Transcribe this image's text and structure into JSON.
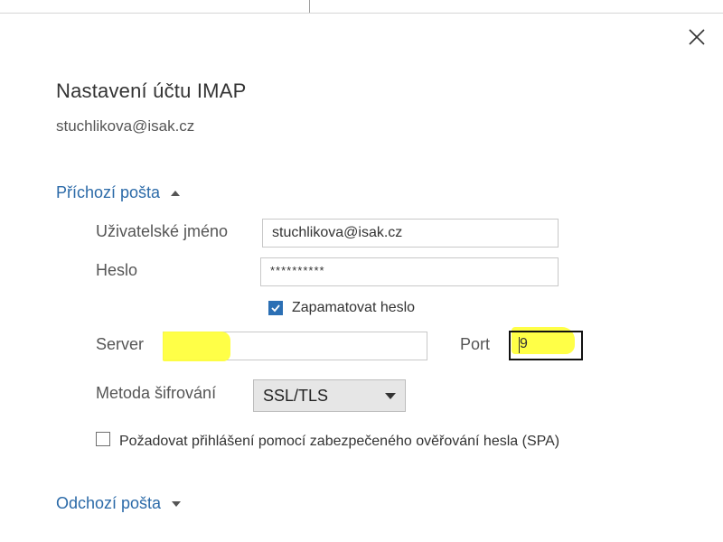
{
  "dialog": {
    "title": "Nastavení účtu IMAP",
    "account_email": "stuchlikova@isak.cz",
    "close_icon": "close-icon"
  },
  "incoming": {
    "section_label": "Příchozí pošta",
    "expanded": true,
    "username_label": "Uživatelské jméno",
    "username_value": "stuchlikova@isak.cz",
    "password_label": "Heslo",
    "password_value": "**********",
    "remember_label": "Zapamatovat heslo",
    "remember_checked": true,
    "server_label": "Server",
    "server_value": "",
    "port_label": "Port",
    "port_value": "9",
    "encryption_label": "Metoda šifrování",
    "encryption_value": "SSL/TLS",
    "spa_label": "Požadovat přihlášení pomocí zabezpečeného ověřování hesla (SPA)",
    "spa_checked": false
  },
  "outgoing": {
    "section_label": "Odchozí pošta",
    "expanded": false
  },
  "colors": {
    "accent": "#2b6fb4",
    "link": "#2b6aa8",
    "highlight": "#ffff33"
  }
}
